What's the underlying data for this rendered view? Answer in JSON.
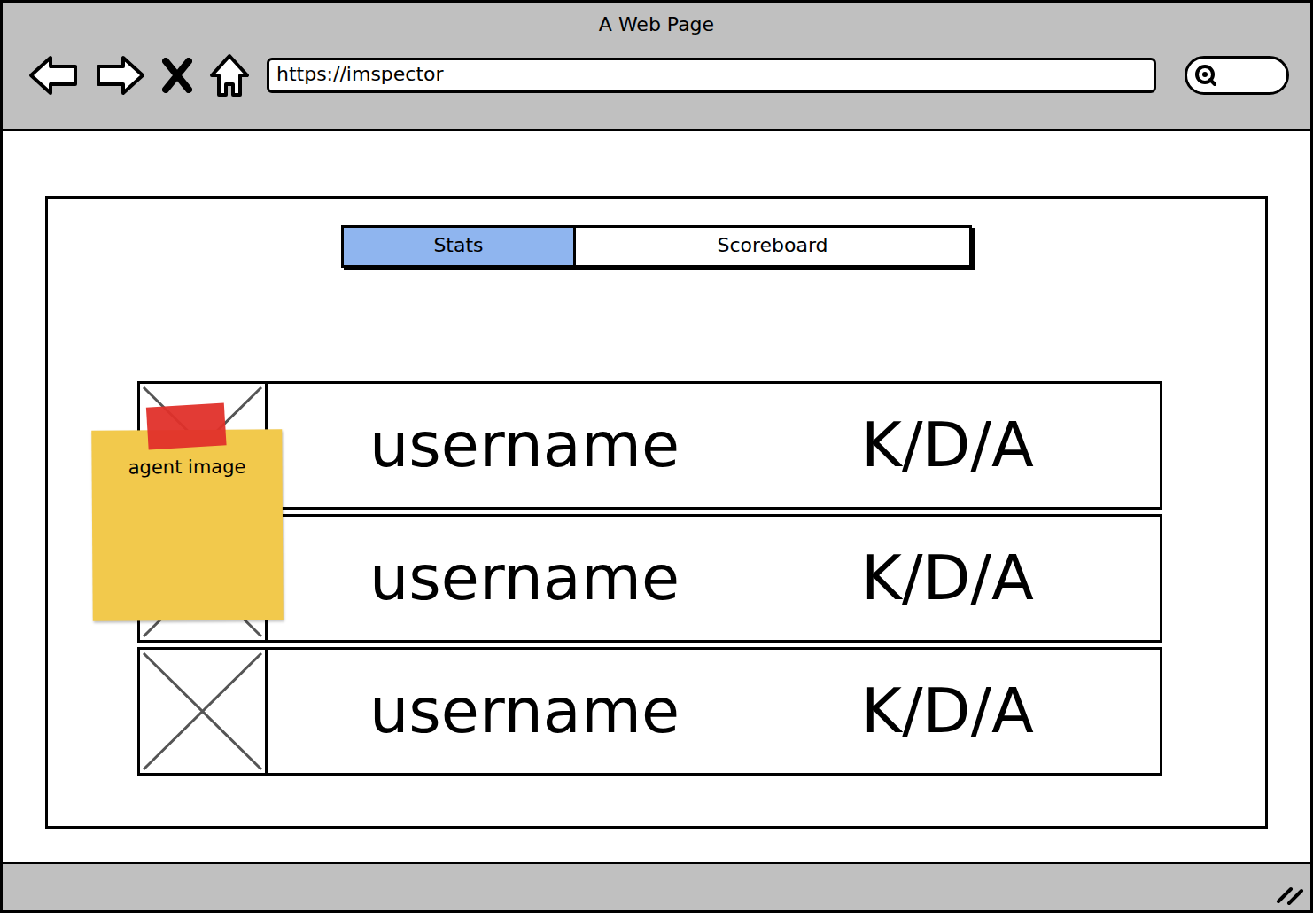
{
  "window": {
    "title": "A Web Page"
  },
  "address_bar": {
    "url": "https://imspector"
  },
  "tabs": [
    {
      "label": "Stats",
      "selected": true
    },
    {
      "label": "Scoreboard",
      "selected": false
    }
  ],
  "players": [
    {
      "username": "username",
      "kda": "K/D/A"
    },
    {
      "username": "username",
      "kda": "K/D/A"
    },
    {
      "username": "username",
      "kda": "K/D/A"
    }
  ],
  "sticky_note": {
    "text": "agent image"
  }
}
